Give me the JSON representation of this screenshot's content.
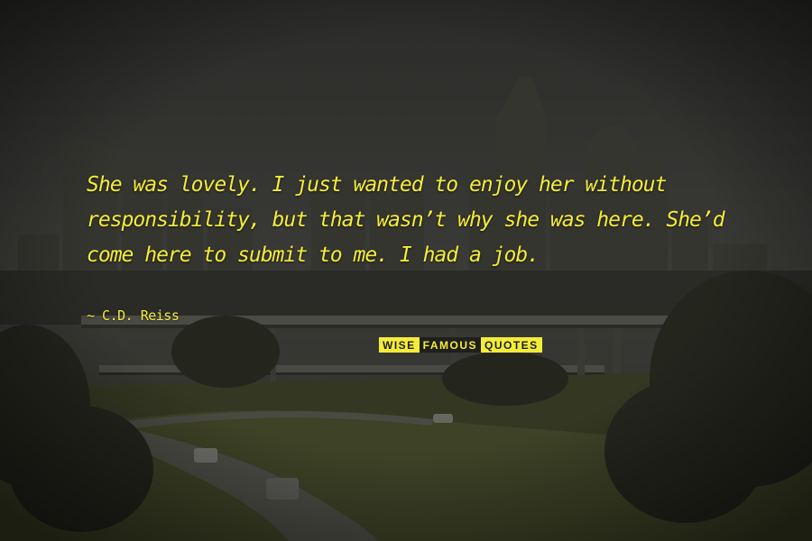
{
  "quote": {
    "lines": [
      "She was lovely. I just wanted to enjoy her without",
      "responsibility, but that wasn’t why she was here. She’d",
      "come here to submit to me. I had a job."
    ],
    "author": "~ C.D. Reiss",
    "color": "#f4ec3a"
  },
  "watermark": {
    "part1": "WISE",
    "part2": "FAMOUS",
    "part3": "QUOTES"
  },
  "scene": {
    "description_colors": {
      "sky": "#3a3a36",
      "buildings": "#2f302c",
      "ground": "#3d3f2a",
      "road": "#4a4a44"
    }
  }
}
